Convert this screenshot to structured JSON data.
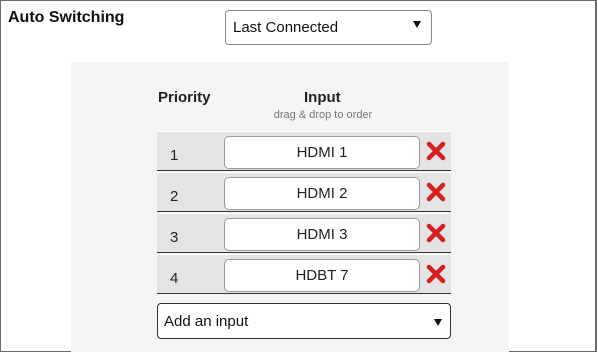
{
  "section": {
    "label": "Auto Switching"
  },
  "mode_select": {
    "value": "Last Connected"
  },
  "priority_list": {
    "header_priority": "Priority",
    "header_input": "Input",
    "header_hint": "drag & drop to order",
    "rows": [
      {
        "priority": "1",
        "input": "HDMI 1"
      },
      {
        "priority": "2",
        "input": "HDMI 2"
      },
      {
        "priority": "3",
        "input": "HDMI 3"
      },
      {
        "priority": "4",
        "input": "HDBT 7"
      }
    ]
  },
  "add_input": {
    "value": "Add an input"
  },
  "icons": {
    "remove": "close-x-icon",
    "dropdown": "caret-down-icon"
  },
  "colors": {
    "remove_icon": "#d62020",
    "row_bg": "#e4e4e4",
    "panel_bg": "#f5f5f5"
  }
}
